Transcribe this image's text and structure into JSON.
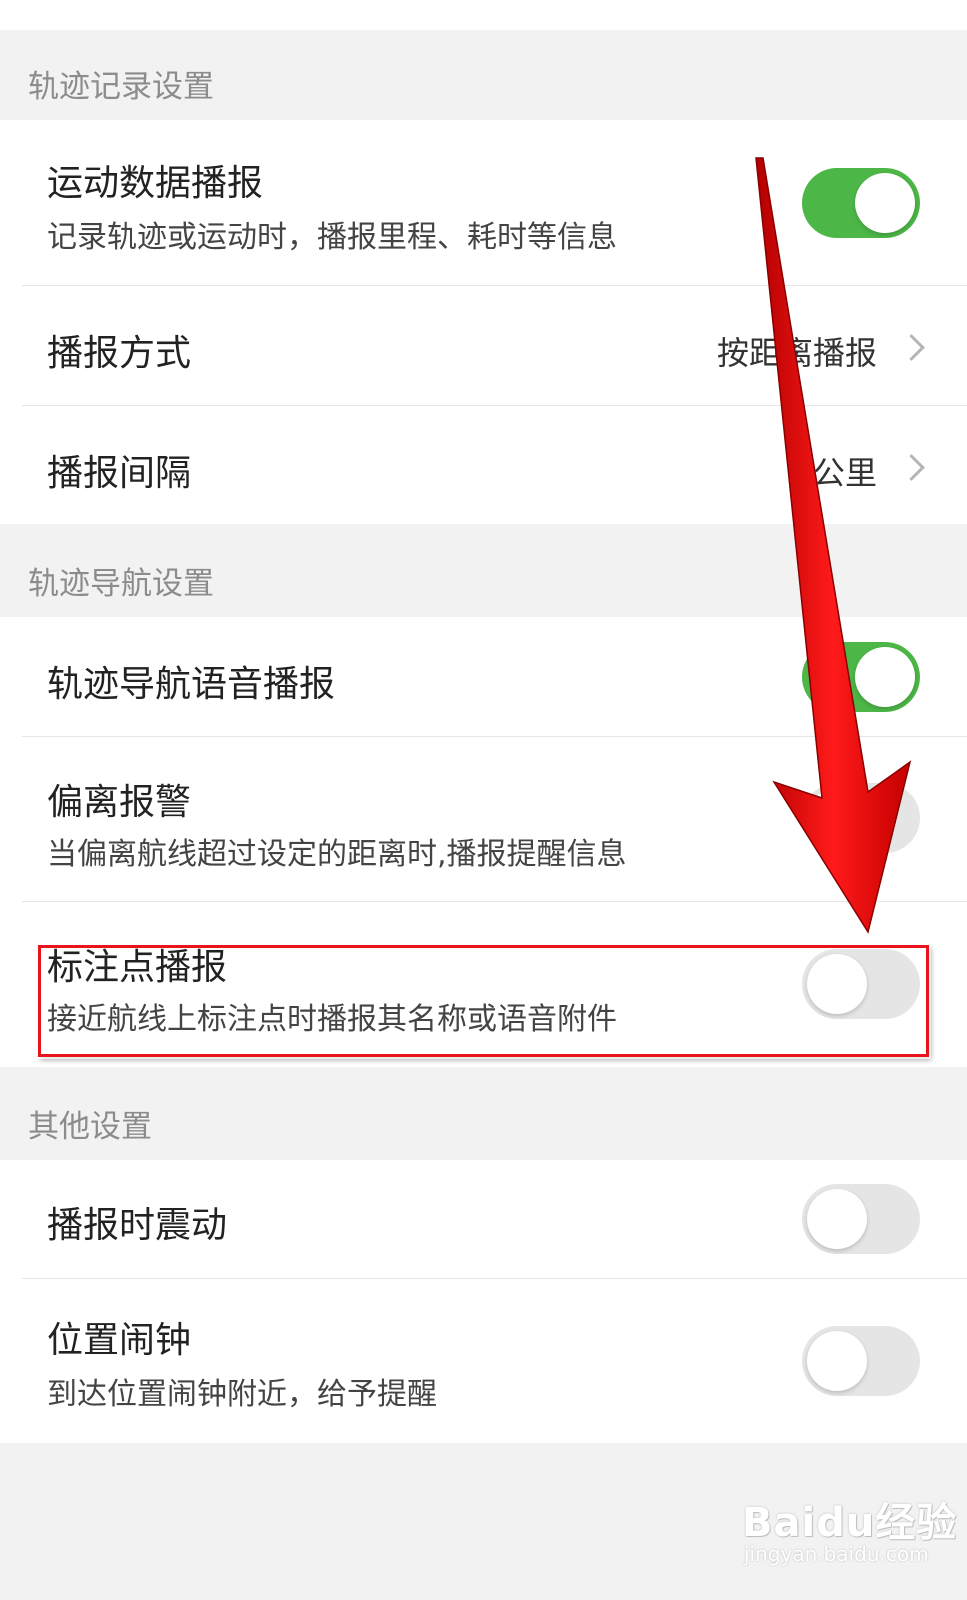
{
  "sections": [
    {
      "header": "轨迹记录设置",
      "rows": [
        {
          "title": "运动数据播报",
          "subtitle": "记录轨迹或运动时，播报里程、耗时等信息",
          "toggle": "on"
        },
        {
          "title": "播报方式",
          "value": "按距离播报"
        },
        {
          "title": "播报间隔",
          "value": "公里"
        }
      ]
    },
    {
      "header": "轨迹导航设置",
      "rows": [
        {
          "title": "轨迹导航语音播报",
          "toggle": "on"
        },
        {
          "title": "偏离报警",
          "subtitle": "当偏离航线超过设定的距离时,播报提醒信息",
          "toggle": "off"
        },
        {
          "title": "标注点播报",
          "subtitle": "接近航线上标注点时播报其名称或语音附件",
          "toggle": "off"
        }
      ]
    },
    {
      "header": "其他设置",
      "rows": [
        {
          "title": "播报时震动",
          "toggle": "off"
        },
        {
          "title": "位置闹钟",
          "subtitle": "到达位置闹钟附近，给予提醒",
          "toggle": "off"
        }
      ]
    }
  ],
  "watermark": {
    "logo": "Baidu经验",
    "url": "jingyan.baidu.com"
  },
  "colors": {
    "toggle_on": "#4cb747",
    "toggle_off": "#e5e5e5",
    "annotation_red": "#e8131b"
  }
}
